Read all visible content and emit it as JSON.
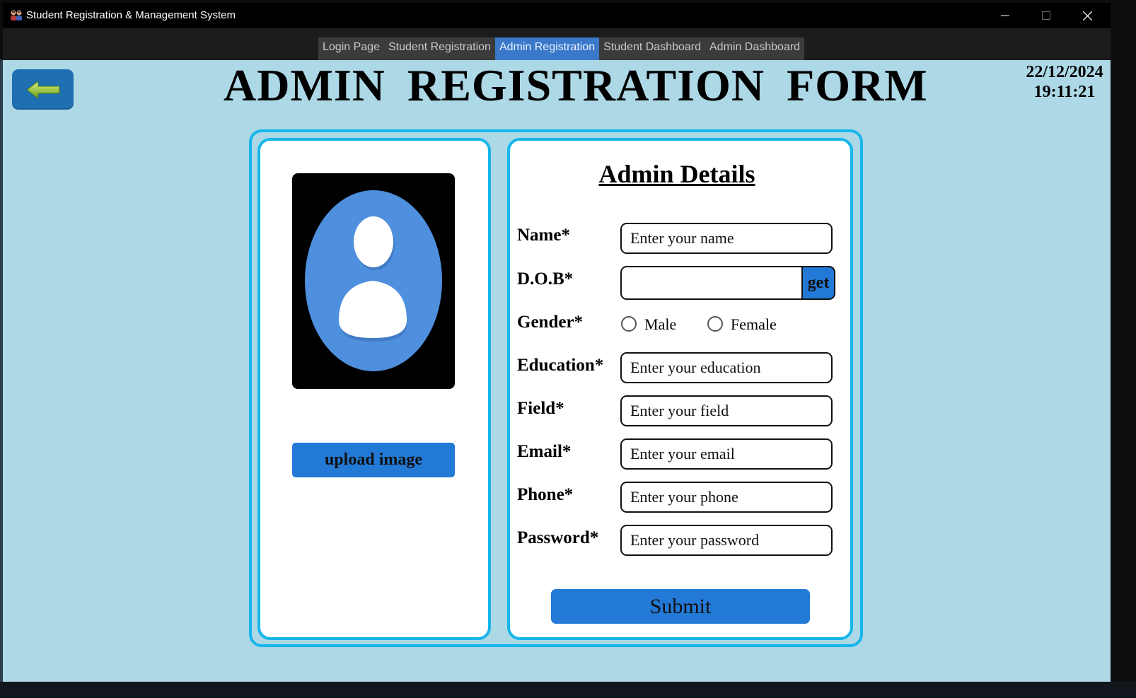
{
  "window": {
    "title": "Student Registration & Management System",
    "icon": "app-students-icon",
    "controls": [
      "minimize-icon",
      "maximize-icon",
      "close-icon"
    ]
  },
  "nav": {
    "tabs": [
      {
        "label": "Login Page",
        "active": false
      },
      {
        "label": "Student Registration",
        "active": false
      },
      {
        "label": "Admin Registration",
        "active": true
      },
      {
        "label": "Student Dashboard",
        "active": false
      },
      {
        "label": "Admin Dashboard",
        "active": false
      }
    ]
  },
  "header": {
    "back_icon": "arrow-left-icon",
    "title": "ADMIN  REGISTRATION  FORM",
    "date": "22/12/2024",
    "time": "19:11:21"
  },
  "photo": {
    "avatar_icon": "user-avatar-icon",
    "upload_label": "upload image"
  },
  "form": {
    "title": "Admin Details",
    "name_label": "Name*",
    "name_placeholder": "Enter your name",
    "dob_label": "D.O.B*",
    "dob_value": "",
    "dob_button": "get",
    "gender_label": "Gender*",
    "gender_male": "Male",
    "gender_female": "Female",
    "education_label": "Education*",
    "education_placeholder": "Enter your education",
    "field_label": "Field*",
    "field_placeholder": "Enter your field",
    "email_label": "Email*",
    "email_placeholder": "Enter your email",
    "phone_label": "Phone*",
    "phone_placeholder": "Enter your phone",
    "password_label": "Password*",
    "password_placeholder": "Enter your password",
    "submit_label": "Submit"
  },
  "colors": {
    "background": "#add8e6",
    "accent_button": "#2279d6",
    "panel_border": "#17b6ea",
    "active_tab": "#3a78c9",
    "back_button": "#1f6fb3"
  }
}
